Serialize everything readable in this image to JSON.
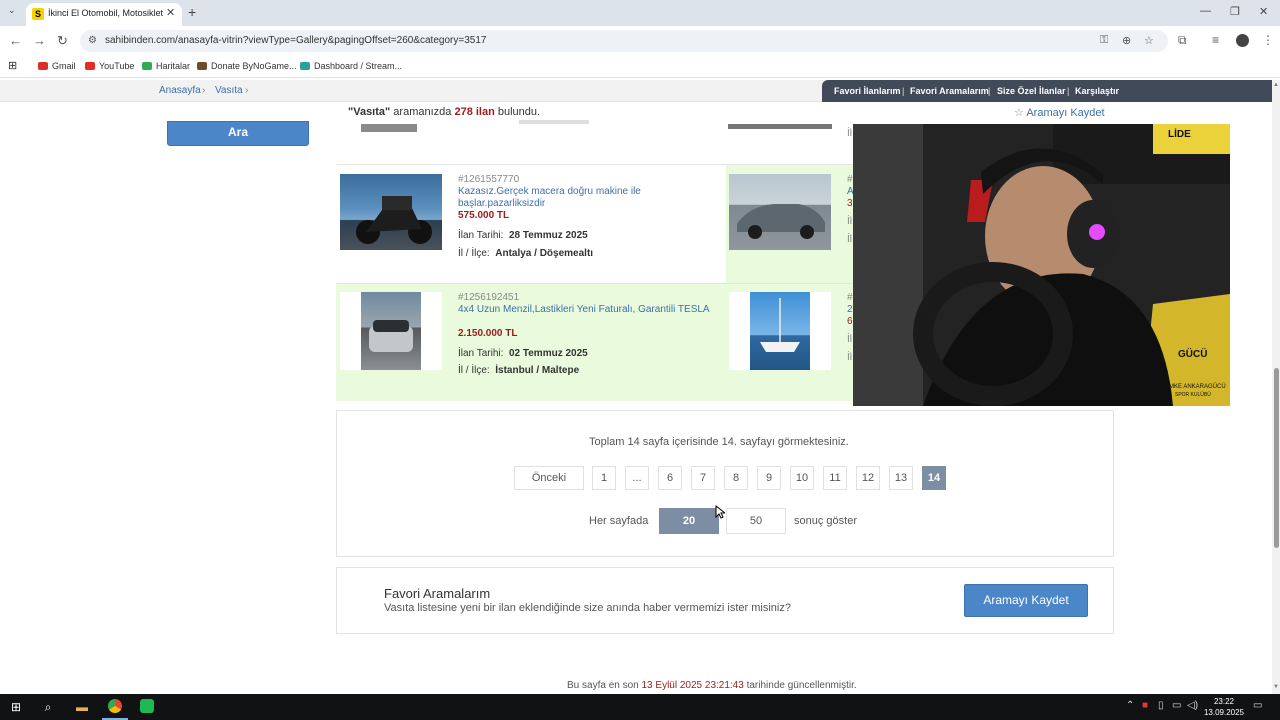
{
  "browser": {
    "tab_title": "İkinci El Otomobil, Motosiklet M",
    "tab_favicon": "S",
    "url": "sahibinden.com/anasayfa-vitrin?viewType=Gallery&pagingOffset=260&category=3517",
    "bookmarks": [
      {
        "label": "Gmail",
        "color": "#d93025"
      },
      {
        "label": "YouTube",
        "color": "#e52d27"
      },
      {
        "label": "Haritalar",
        "color": "#34a853"
      },
      {
        "label": "Donate ByNoGame...",
        "color": "#6b4f2c"
      },
      {
        "label": "Dashboard / Stream...",
        "color": "#2aa198"
      }
    ]
  },
  "breadcrumb": {
    "items": [
      "Anasayfa",
      "Vasıta"
    ]
  },
  "top_menu": [
    "Favori İlanlarım",
    "Favori Aramalarım",
    "Size Özel İlanlar",
    "Karşılaştır"
  ],
  "results": {
    "query": "\"Vasıta\"",
    "mid": "aramanızda",
    "count": "278 ilan",
    "suffix": "bulundu.",
    "save_link": "Aramayı Kaydet"
  },
  "search_button": "Ara",
  "listings": [
    {
      "id": "#1261557770",
      "title": "Kazasız.Gerçek macera doğru makine ile başlar.pazarliksizdir",
      "price": "575.000 TL",
      "date_label": "İlan Tarihi:",
      "date": "28 Temmuz 2025",
      "loc_label": "İl / İlçe:",
      "location": "Antalya / Döşemealtı"
    },
    {
      "id": "#1256192451",
      "title": "4x4 Uzun Menzil,Lastikleri Yeni Faturalı, Garantili TESLA",
      "price": "2.150.000 TL",
      "date_label": "İlan Tarihi:",
      "date": "02 Temmuz 2025",
      "loc_label": "İl / İlçe:",
      "location": "İstanbul / Maltepe"
    }
  ],
  "peek": {
    "r1a": "#",
    "r1b": "A",
    "r1c": "3",
    "r1d": "İl",
    "r1e": "İl",
    "r2a": "#",
    "r2b": "2",
    "r2c": "6",
    "r2d": "İl",
    "r2e": "İl"
  },
  "webcam": {
    "wall_text": "LİDE",
    "badge_text": "MKE ANKARAGÜCÜ",
    "badge_sub": "SPOR KULÜBÜ",
    "badge_mid": "GÜCÜ"
  },
  "pagination": {
    "summary": "Toplam 14 sayfa içerisinde 14. sayfayı görmektesiniz.",
    "prev_label": "Önceki",
    "pages": [
      "1",
      "...",
      "6",
      "7",
      "8",
      "9",
      "10",
      "11",
      "12",
      "13",
      "14"
    ],
    "current": "14",
    "per_page_label": "Her sayfada",
    "per_page_options": [
      "20",
      "50"
    ],
    "per_page_selected": "20",
    "per_page_suffix": "sonuç göster"
  },
  "favorites": {
    "title": "Favori Aramalarım",
    "subtitle": "Vasıta listesine yeni bir ilan eklendiğinde size anında haber vermemizi ister misiniz?",
    "button": "Aramayı Kaydet"
  },
  "footer": {
    "prefix": "Bu sayfa en son",
    "datetime": "13 Eylül 2025 23:21:43",
    "suffix": "tarihinde güncellenmiştir."
  },
  "taskbar": {
    "time": "23:22",
    "date": "13.09.2025"
  },
  "colors": {
    "accent": "#4b86c9",
    "price": "#9b1c1c",
    "highlight_row": "#e9fbdc",
    "menu_bg": "#404a58"
  }
}
